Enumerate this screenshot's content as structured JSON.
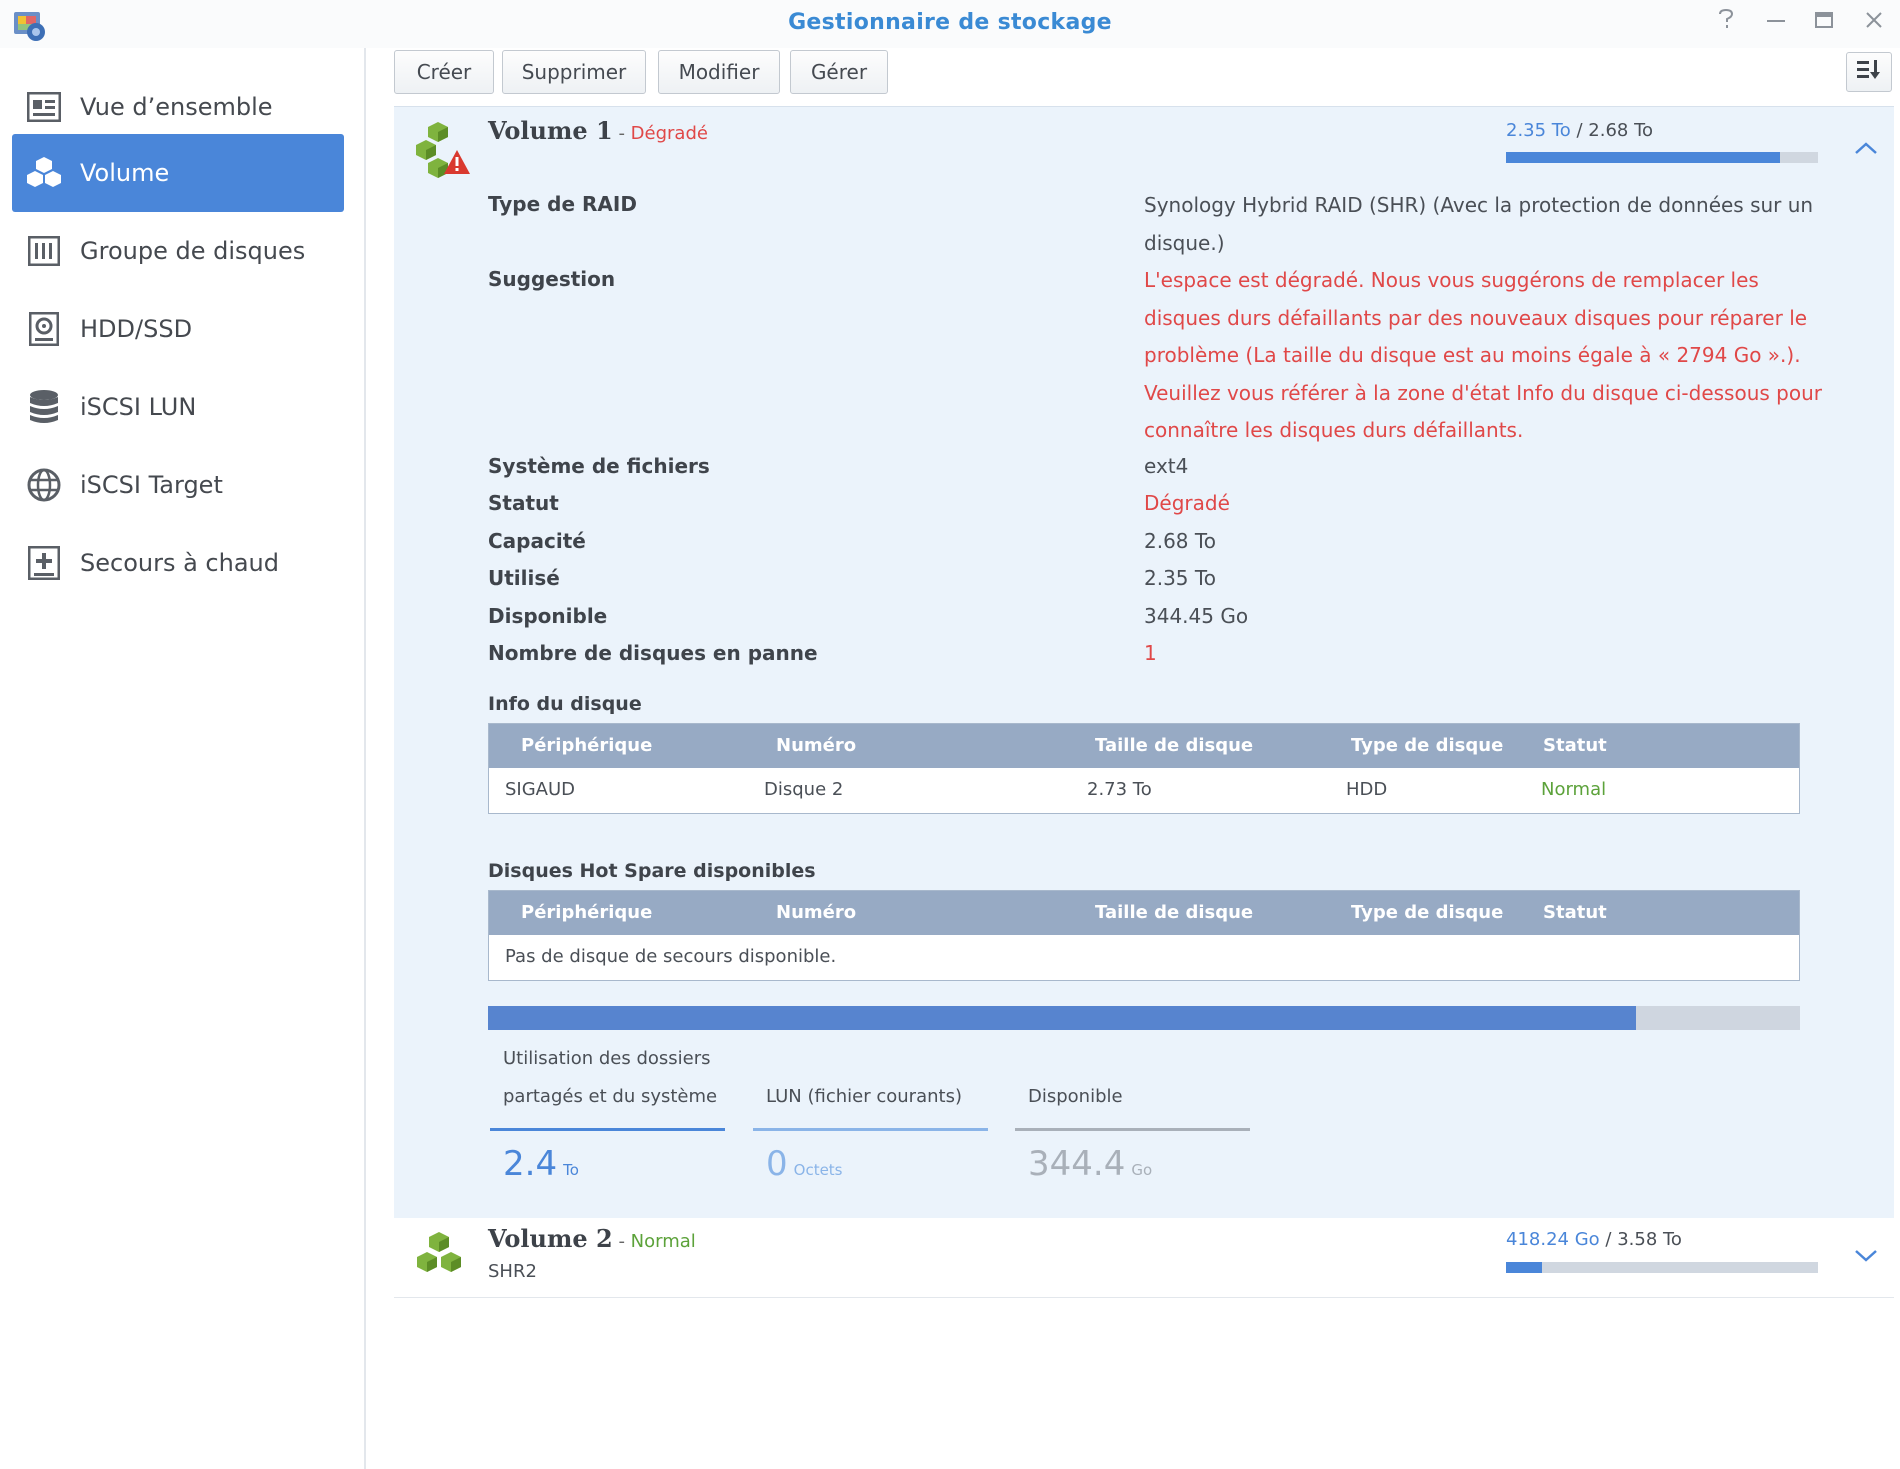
{
  "window": {
    "title": "Gestionnaire de stockage",
    "help_icon": "help-icon",
    "minimize_icon": "minimize-icon",
    "maximize_icon": "maximize-icon",
    "close_icon": "close-icon"
  },
  "sidebar": {
    "items": [
      {
        "label": "Vue d’ensemble",
        "icon": "overview-icon",
        "active": false
      },
      {
        "label": "Volume",
        "icon": "volume-icon",
        "active": true
      },
      {
        "label": "Groupe de disques",
        "icon": "disk-group-icon",
        "active": false
      },
      {
        "label": "HDD/SSD",
        "icon": "hdd-icon",
        "active": false
      },
      {
        "label": "iSCSI LUN",
        "icon": "database-icon",
        "active": false
      },
      {
        "label": "iSCSI Target",
        "icon": "globe-icon",
        "active": false
      },
      {
        "label": "Secours à chaud",
        "icon": "hot-spare-icon",
        "active": false
      }
    ]
  },
  "toolbar": {
    "create": "Créer",
    "delete": "Supprimer",
    "modify": "Modifier",
    "manage": "Gérer",
    "sort_icon": "sort-icon"
  },
  "volume1": {
    "name": "Volume 1",
    "separator": " - ",
    "status": "Dégradé",
    "usage_used": "2.35 To",
    "usage_sep": " / ",
    "usage_total": "2.68 To",
    "usage_fraction": 0.877,
    "expanded": true,
    "props": {
      "raid_label": "Type de RAID",
      "raid_value": "Synology Hybrid RAID (SHR) (Avec la protection de données sur un disque.)",
      "suggestion_label": "Suggestion",
      "suggestion_value": "L'espace est dégradé. Nous vous suggérons de remplacer les disques durs défaillants par des nouveaux disques pour réparer le problème (La taille du disque est au moins égale à « 2794 Go ».). Veuillez vous référer à la zone d'état Info du disque ci-dessous pour connaître les disques durs défaillants.",
      "fs_label": "Système de fichiers",
      "fs_value": "ext4",
      "status_label": "Statut",
      "status_value": "Dégradé",
      "capacity_label": "Capacité",
      "capacity_value": "2.68 To",
      "used_label": "Utilisé",
      "used_value": "2.35 To",
      "available_label": "Disponible",
      "available_value": "344.45 Go",
      "failed_label": "Nombre de disques en panne",
      "failed_value": "1"
    },
    "disk_info": {
      "title": "Info du disque",
      "columns": [
        "Périphérique",
        "Numéro",
        "Taille de disque",
        "Type de disque",
        "Statut"
      ],
      "rows": [
        [
          "SIGAUD",
          "Disque 2",
          "2.73 To",
          "HDD",
          "Normal"
        ]
      ]
    },
    "hot_spare": {
      "title": "Disques Hot Spare disponibles",
      "columns": [
        "Périphérique",
        "Numéro",
        "Taille de disque",
        "Type de disque",
        "Statut"
      ],
      "empty_message": "Pas de disque de secours disponible."
    },
    "allocation_bar_fraction": 0.875,
    "legend": [
      {
        "label_line1": "Utilisation des dossiers",
        "label_line2": "partagés et du système",
        "value": "2.4",
        "unit": "To",
        "color": "#4a86d9"
      },
      {
        "label_line1": "",
        "label_line2": "LUN (fichier courants)",
        "value": "0",
        "unit": "Octets",
        "color": "#8ab4e8"
      },
      {
        "label_line1": "",
        "label_line2": "Disponible",
        "value": "344.4",
        "unit": "Go",
        "color": "#a9b0b9"
      }
    ]
  },
  "volume2": {
    "name": "Volume 2",
    "separator": " - ",
    "status": "Normal",
    "subtitle": "SHR2",
    "usage_used": "418.24 Go",
    "usage_sep": " / ",
    "usage_total": "3.58 To",
    "usage_fraction": 0.114,
    "expanded": false
  },
  "colors": {
    "accent": "#4a86d9",
    "title": "#3a8ad4",
    "degraded": "#e04848",
    "normal": "#5ca23a",
    "panel_bg": "#ebf3fb"
  }
}
